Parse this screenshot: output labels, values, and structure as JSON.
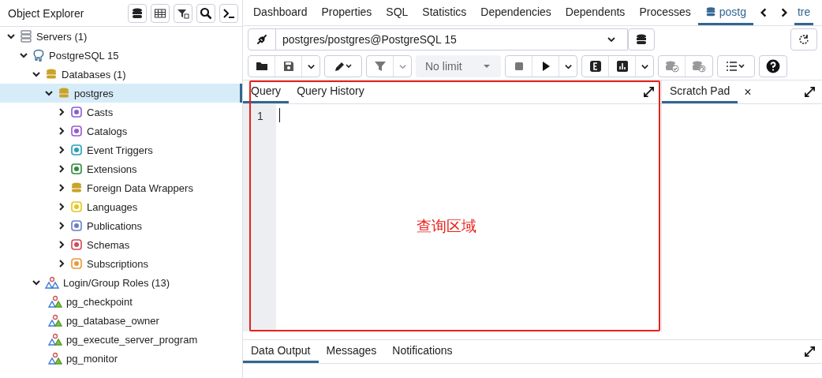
{
  "explorer": {
    "title": "Object Explorer"
  },
  "tree": [
    {
      "label": "Servers (1)",
      "kind": "servers",
      "expanded": true,
      "selected": false,
      "children": [
        {
          "label": "PostgreSQL 15",
          "kind": "server",
          "expanded": true,
          "selected": false,
          "children": [
            {
              "label": "Databases (1)",
              "kind": "databases",
              "expanded": true,
              "selected": false,
              "children": [
                {
                  "label": "postgres",
                  "kind": "database",
                  "expanded": true,
                  "selected": true,
                  "children": [
                    {
                      "label": "Casts",
                      "kind": "casts",
                      "expanded": false,
                      "selected": false
                    },
                    {
                      "label": "Catalogs",
                      "kind": "catalogs",
                      "expanded": false,
                      "selected": false
                    },
                    {
                      "label": "Event Triggers",
                      "kind": "triggers",
                      "expanded": false,
                      "selected": false
                    },
                    {
                      "label": "Extensions",
                      "kind": "extensions",
                      "expanded": false,
                      "selected": false
                    },
                    {
                      "label": "Foreign Data Wrappers",
                      "kind": "fdw",
                      "expanded": false,
                      "selected": false
                    },
                    {
                      "label": "Languages",
                      "kind": "languages",
                      "expanded": false,
                      "selected": false
                    },
                    {
                      "label": "Publications",
                      "kind": "publications",
                      "expanded": false,
                      "selected": false
                    },
                    {
                      "label": "Schemas",
                      "kind": "schemas",
                      "expanded": false,
                      "selected": false
                    },
                    {
                      "label": "Subscriptions",
                      "kind": "subscriptions",
                      "expanded": false,
                      "selected": false
                    }
                  ]
                }
              ]
            },
            {
              "label": "Login/Group Roles (13)",
              "kind": "roles",
              "expanded": true,
              "selected": false,
              "children": [
                {
                  "label": "pg_checkpoint",
                  "kind": "role",
                  "selected": false
                },
                {
                  "label": "pg_database_owner",
                  "kind": "role",
                  "selected": false
                },
                {
                  "label": "pg_execute_server_program",
                  "kind": "role",
                  "selected": false
                },
                {
                  "label": "pg_monitor",
                  "kind": "role",
                  "selected": false
                }
              ]
            }
          ]
        }
      ]
    }
  ],
  "tabs": [
    {
      "label": "Dashboard",
      "selected": false
    },
    {
      "label": "Properties",
      "selected": false
    },
    {
      "label": "SQL",
      "selected": false
    },
    {
      "label": "Statistics",
      "selected": false
    },
    {
      "label": "Dependencies",
      "selected": false
    },
    {
      "label": "Dependents",
      "selected": false
    },
    {
      "label": "Processes",
      "selected": false
    },
    {
      "label": "postg",
      "selected": true
    }
  ],
  "overflow_tab": {
    "label": "tre"
  },
  "connection": {
    "value": "postgres/postgres@PostgreSQL 15"
  },
  "toolbar": {
    "limit": "No limit"
  },
  "query_tabs": [
    {
      "label": "Query",
      "selected": true
    },
    {
      "label": "Query History",
      "selected": false
    }
  ],
  "editor": {
    "line_numbers": [
      "1"
    ]
  },
  "scratch_pad": {
    "label": "Scratch Pad",
    "close": "×"
  },
  "annotation": {
    "text": "查询区域"
  },
  "output_tabs": [
    {
      "label": "Data Output",
      "selected": true
    },
    {
      "label": "Messages",
      "selected": false
    },
    {
      "label": "Notifications",
      "selected": false
    }
  ]
}
